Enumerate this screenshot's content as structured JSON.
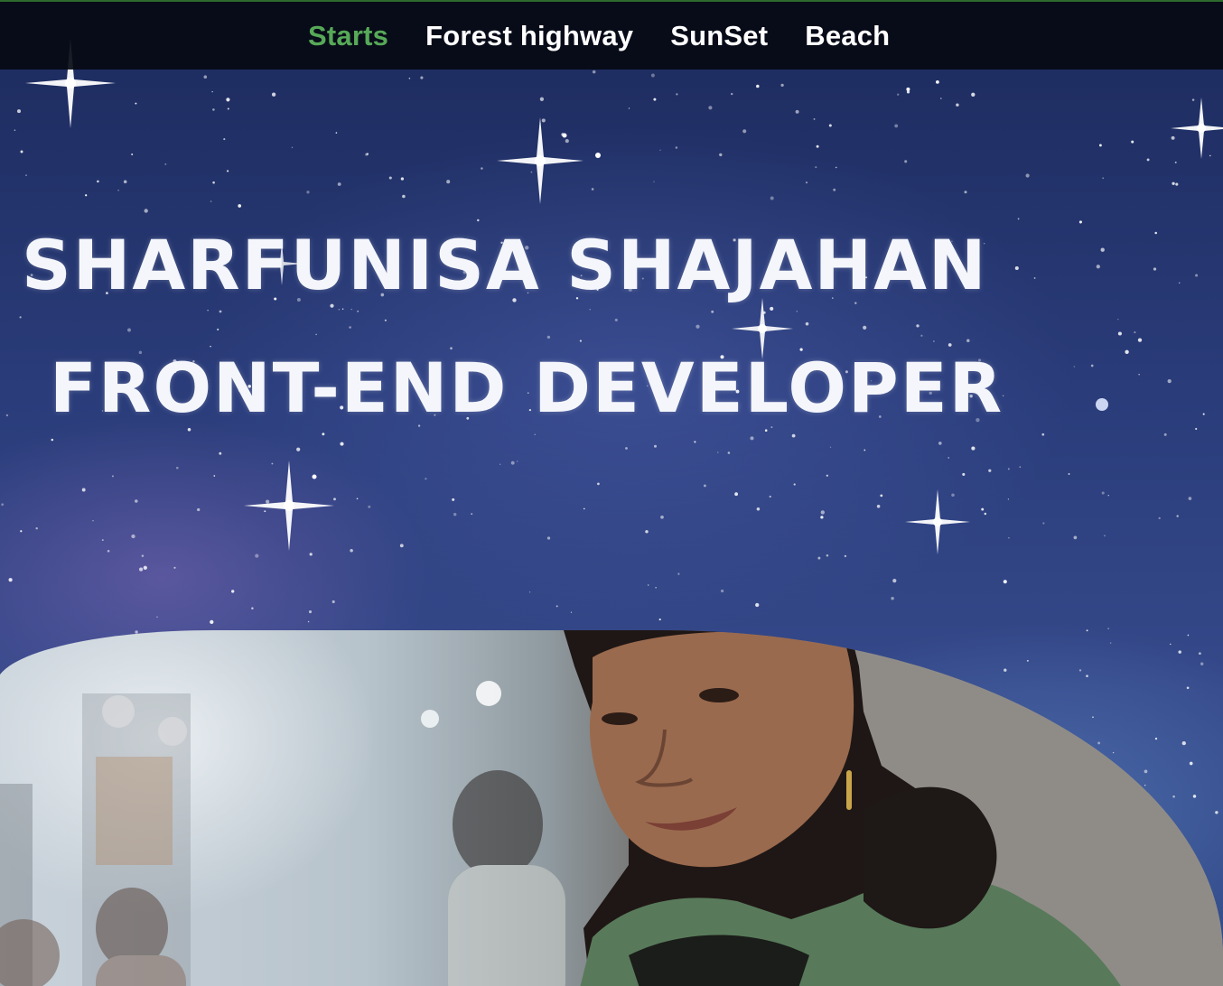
{
  "nav": {
    "items": [
      {
        "label": "Starts",
        "active": true
      },
      {
        "label": "Forest highway",
        "active": false
      },
      {
        "label": "SunSet",
        "active": false
      },
      {
        "label": "Beach",
        "active": false
      }
    ],
    "active_color": "#57a957"
  },
  "hero": {
    "name": "SHARFUNISA SHAJAHAN",
    "role": "FRONT-END DEVELOPER"
  }
}
